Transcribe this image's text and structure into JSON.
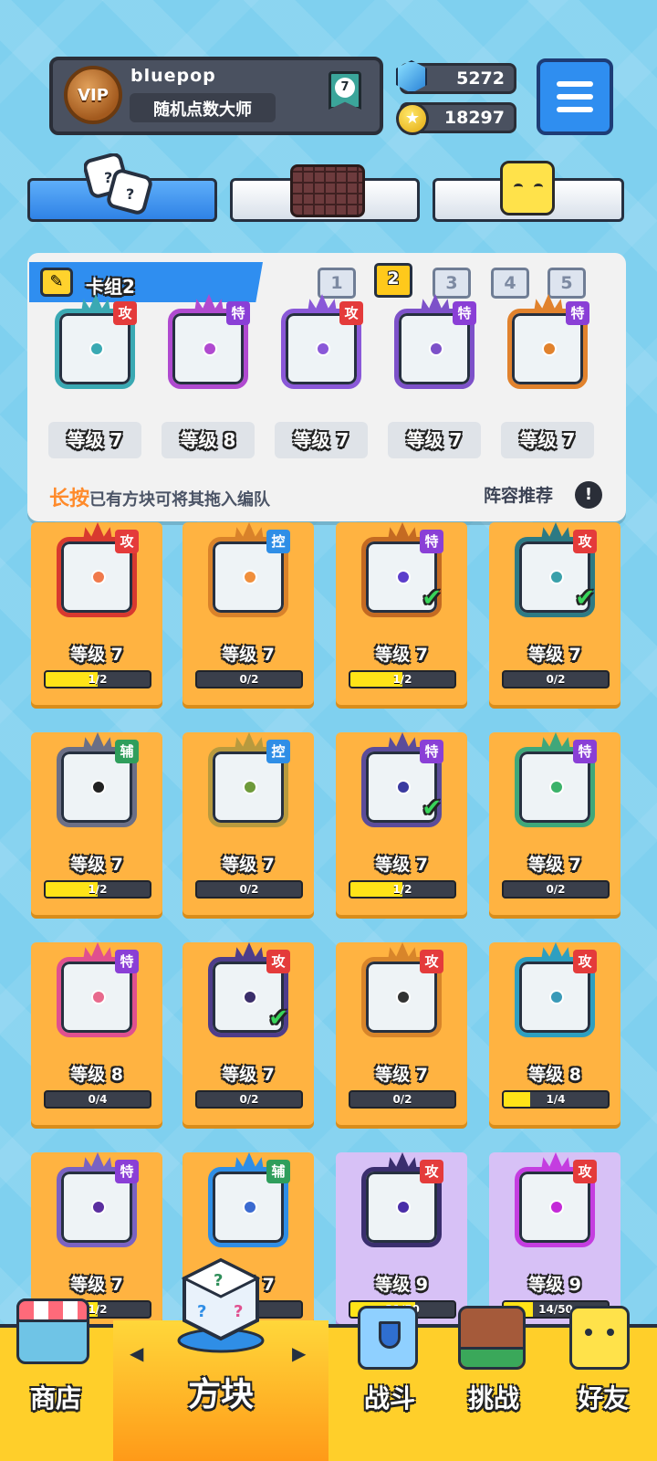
{
  "profile": {
    "username": "bluepop",
    "title": "随机点数大师",
    "vip_label": "VIP",
    "rank": "7"
  },
  "currency": {
    "gems": "5272",
    "coins": "18297"
  },
  "deck": {
    "name": "卡组2",
    "slots": [
      "1",
      "2",
      "3",
      "4",
      "5"
    ],
    "active_slot": "2",
    "dice": [
      {
        "tag": "攻",
        "level": "等级 7",
        "color": "#3aa9b3"
      },
      {
        "tag": "特",
        "level": "等级 8",
        "color": "#b04ad0"
      },
      {
        "tag": "攻",
        "level": "等级 7",
        "color": "#8a58d8"
      },
      {
        "tag": "特",
        "level": "等级 7",
        "color": "#7d51c9"
      },
      {
        "tag": "特",
        "level": "等级 7",
        "color": "#e1822d"
      }
    ],
    "hint_highlight": "长按",
    "hint_text": "已有方块可将其拖入编队",
    "recommend": "阵容推荐"
  },
  "collection": [
    {
      "tag": "攻",
      "level": "等级 7",
      "progress": "1/2",
      "ratio": 0.5,
      "color": "#d8392f",
      "dot": "#f07a4c",
      "checked": false,
      "rarity": "normal"
    },
    {
      "tag": "控",
      "level": "等级 7",
      "progress": "0/2",
      "ratio": 0,
      "color": "#d9822a",
      "dot": "#f08f3c",
      "checked": false,
      "rarity": "normal"
    },
    {
      "tag": "特",
      "level": "等级 7",
      "progress": "1/2",
      "ratio": 0.5,
      "color": "#c46a22",
      "dot": "#5c3ecb",
      "checked": true,
      "rarity": "normal"
    },
    {
      "tag": "攻",
      "level": "等级 7",
      "progress": "0/2",
      "ratio": 0,
      "color": "#2d7a84",
      "dot": "#3aa0aa",
      "checked": true,
      "rarity": "normal"
    },
    {
      "tag": "辅",
      "level": "等级 7",
      "progress": "1/2",
      "ratio": 0.5,
      "color": "#6b6f86",
      "dot": "#222",
      "checked": false,
      "rarity": "normal"
    },
    {
      "tag": "控",
      "level": "等级 7",
      "progress": "0/2",
      "ratio": 0,
      "color": "#b89a3e",
      "dot": "#6e9a3a",
      "checked": false,
      "rarity": "normal"
    },
    {
      "tag": "特",
      "level": "等级 7",
      "progress": "1/2",
      "ratio": 0.5,
      "color": "#5b4c9a",
      "dot": "#3a3aa0",
      "checked": true,
      "rarity": "normal"
    },
    {
      "tag": "特",
      "level": "等级 7",
      "progress": "0/2",
      "ratio": 0,
      "color": "#3fa77a",
      "dot": "#3bb26a",
      "checked": false,
      "rarity": "normal"
    },
    {
      "tag": "特",
      "level": "等级 8",
      "progress": "0/4",
      "ratio": 0,
      "color": "#e0508f",
      "dot": "#e86a8d",
      "checked": false,
      "rarity": "normal"
    },
    {
      "tag": "攻",
      "level": "等级 7",
      "progress": "0/2",
      "ratio": 0,
      "color": "#4e3d8a",
      "dot": "#3b2e6a",
      "checked": true,
      "rarity": "normal"
    },
    {
      "tag": "攻",
      "level": "等级 7",
      "progress": "0/2",
      "ratio": 0,
      "color": "#d8852a",
      "dot": "#333",
      "checked": false,
      "rarity": "normal"
    },
    {
      "tag": "攻",
      "level": "等级 8",
      "progress": "1/4",
      "ratio": 0.25,
      "color": "#2e9fc0",
      "dot": "#3a9ab8",
      "checked": false,
      "rarity": "normal"
    },
    {
      "tag": "特",
      "level": "等级 7",
      "progress": "1/2",
      "ratio": 0.5,
      "color": "#7a62c2",
      "dot": "#5b2fa0",
      "checked": false,
      "rarity": "normal"
    },
    {
      "tag": "辅",
      "level": "等级 7",
      "progress": "",
      "ratio": 0,
      "color": "#2f8ee6",
      "dot": "#3b6ad0",
      "checked": false,
      "rarity": "normal"
    },
    {
      "tag": "攻",
      "level": "等级 9",
      "progress": "31/50",
      "ratio": 0.62,
      "color": "#3a2e6e",
      "dot": "#4a2ea8",
      "checked": false,
      "rarity": "epic"
    },
    {
      "tag": "攻",
      "level": "等级 9",
      "progress": "14/50",
      "ratio": 0.28,
      "color": "#c43de0",
      "dot": "#c42ad8",
      "checked": false,
      "rarity": "epic"
    }
  ],
  "tag_colors": {
    "攻": "#e43b3b",
    "特": "#8a3fd6",
    "控": "#2f8ee6",
    "辅": "#2f9e5c"
  },
  "nav": {
    "shop": "商店",
    "blocks": "方块",
    "battle": "战斗",
    "challenge": "挑战",
    "friends": "好友"
  }
}
